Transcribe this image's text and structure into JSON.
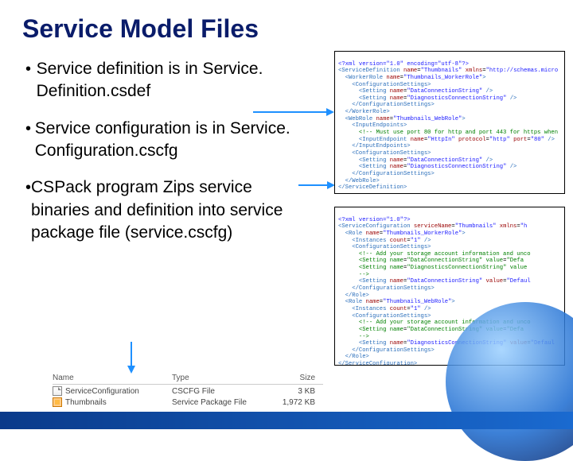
{
  "title": "Service Model Files",
  "bullets": [
    "Service definition is in Service.​Definition.​csdef",
    "Service configuration is in Service.​Configuration.​cscfg",
    "CSPack program Zips service binaries and definition into service package file (service.​cscfg)"
  ],
  "code_csdef": {
    "l1": "<?xml version=\"1.0\" encoding=\"utf-8\"?>",
    "l2_open": "<ServiceDefinition",
    "l2_a1n": "name",
    "l2_a1v": "\"Thumbnails\"",
    "l2_a2n": "xmlns",
    "l2_a2v": "\"http://schemas.micro",
    "l3_open": "  <WorkerRole",
    "l3_a1n": "name",
    "l3_a1v": "\"Thumbnails_WorkerRole\"",
    "l3_close": ">",
    "l4": "    <ConfigurationSettings>",
    "l5_open": "      <Setting",
    "l5_a1n": "name",
    "l5_a1v": "\"DataConnectionString\"",
    "l5_end": "/>",
    "l6_open": "      <Setting",
    "l6_a1n": "name",
    "l6_a1v": "\"DiagnosticsConnectionString\"",
    "l6_end": "/>",
    "l7": "    </ConfigurationSettings>",
    "l8": "  </WorkerRole>",
    "l9_open": "  <WebRole",
    "l9_a1n": "name",
    "l9_a1v": "\"Thumbnails_WebRole\"",
    "l9_close": ">",
    "l10": "    <InputEndpoints>",
    "l11": "      <!-- Must use port 80 for http and port 443 for https when",
    "l12_open": "      <InputEndpoint",
    "l12_a1n": "name",
    "l12_a1v": "\"HttpIn\"",
    "l12_a2n": "protocol",
    "l12_a2v": "\"http\"",
    "l12_a3n": "port",
    "l12_a3v": "\"80\"",
    "l12_end": "/>",
    "l13": "    </InputEndpoints>",
    "l14": "    <ConfigurationSettings>",
    "l15_open": "      <Setting",
    "l15_a1n": "name",
    "l15_a1v": "\"DataConnectionString\"",
    "l15_end": "/>",
    "l16_open": "      <Setting",
    "l16_a1n": "name",
    "l16_a1v": "\"DiagnosticsConnectionString\"",
    "l16_end": "/>",
    "l17": "    </ConfigurationSettings>",
    "l18": "  </WebRole>",
    "l19": "</ServiceDefinition>"
  },
  "code_cscfg": {
    "l1": "<?xml version=\"1.0\"?>",
    "l2_open": "<ServiceConfiguration",
    "l2_a1n": "serviceName",
    "l2_a1v": "\"Thumbnails\"",
    "l2_a2n": "xmlns",
    "l2_a2v": "\"h",
    "l3_open": "  <Role",
    "l3_a1n": "name",
    "l3_a1v": "\"Thumbnails_WorkerRole\"",
    "l3_close": ">",
    "l4_open": "    <Instances",
    "l4_a1n": "count",
    "l4_a1v": "\"1\"",
    "l4_end": "/>",
    "l5": "    <ConfigurationSettings>",
    "l6": "      <!-- Add your storage account information and unco",
    "l7_open": "      <Setting",
    "l7_a1n": "name",
    "l7_a1v": "\"DataConnectionString\"",
    "l7_a2n": "value",
    "l7_a2v": "\"Defa",
    "l8_open": "      <Setting",
    "l8_a1n": "name",
    "l8_a1v": "\"DiagnosticsConnectionString\"",
    "l8_a2n": "value",
    "l8_a2v": "",
    "l9": "      -->",
    "l10_open": "      <Setting",
    "l10_a1n": "name",
    "l10_a1v": "\"DataConnectionString\"",
    "l10_a2n": "value",
    "l10_a2v": "\"Defaul",
    "l11": "    </ConfigurationSettings>",
    "l12": "  </Role>",
    "l13_open": "  <Role",
    "l13_a1n": "name",
    "l13_a1v": "\"Thumbnails_WebRole\"",
    "l13_close": ">",
    "l14_open": "    <Instances",
    "l14_a1n": "count",
    "l14_a1v": "\"1\"",
    "l14_end": "/>",
    "l15": "    <ConfigurationSettings>",
    "l16": "      <!-- Add your storage account information and unco",
    "l17_open": "      <Setting",
    "l17_a1n": "name",
    "l17_a1v": "\"DataConnectionString\"",
    "l17_a2n": "value",
    "l17_a2v": "\"Defa",
    "l18": "      -->",
    "l19_open": "      <Setting",
    "l19_a1n": "name",
    "l19_a1v": "\"DiagnosticsConnectionString\"",
    "l19_a2n": "value",
    "l19_a2v": "\"Defaul",
    "l20": "    </ConfigurationSettings>",
    "l21": "  </Role>",
    "l22": "</ServiceConfiguration>"
  },
  "filelist": {
    "headers": {
      "c1": "Name",
      "c2": "Type",
      "c3": "Size"
    },
    "rows": [
      {
        "name": "ServiceConfiguration",
        "type": "CSCFG File",
        "size": "3 KB"
      },
      {
        "name": "Thumbnails",
        "type": "Service Package File",
        "size": "1,972 KB"
      }
    ]
  }
}
